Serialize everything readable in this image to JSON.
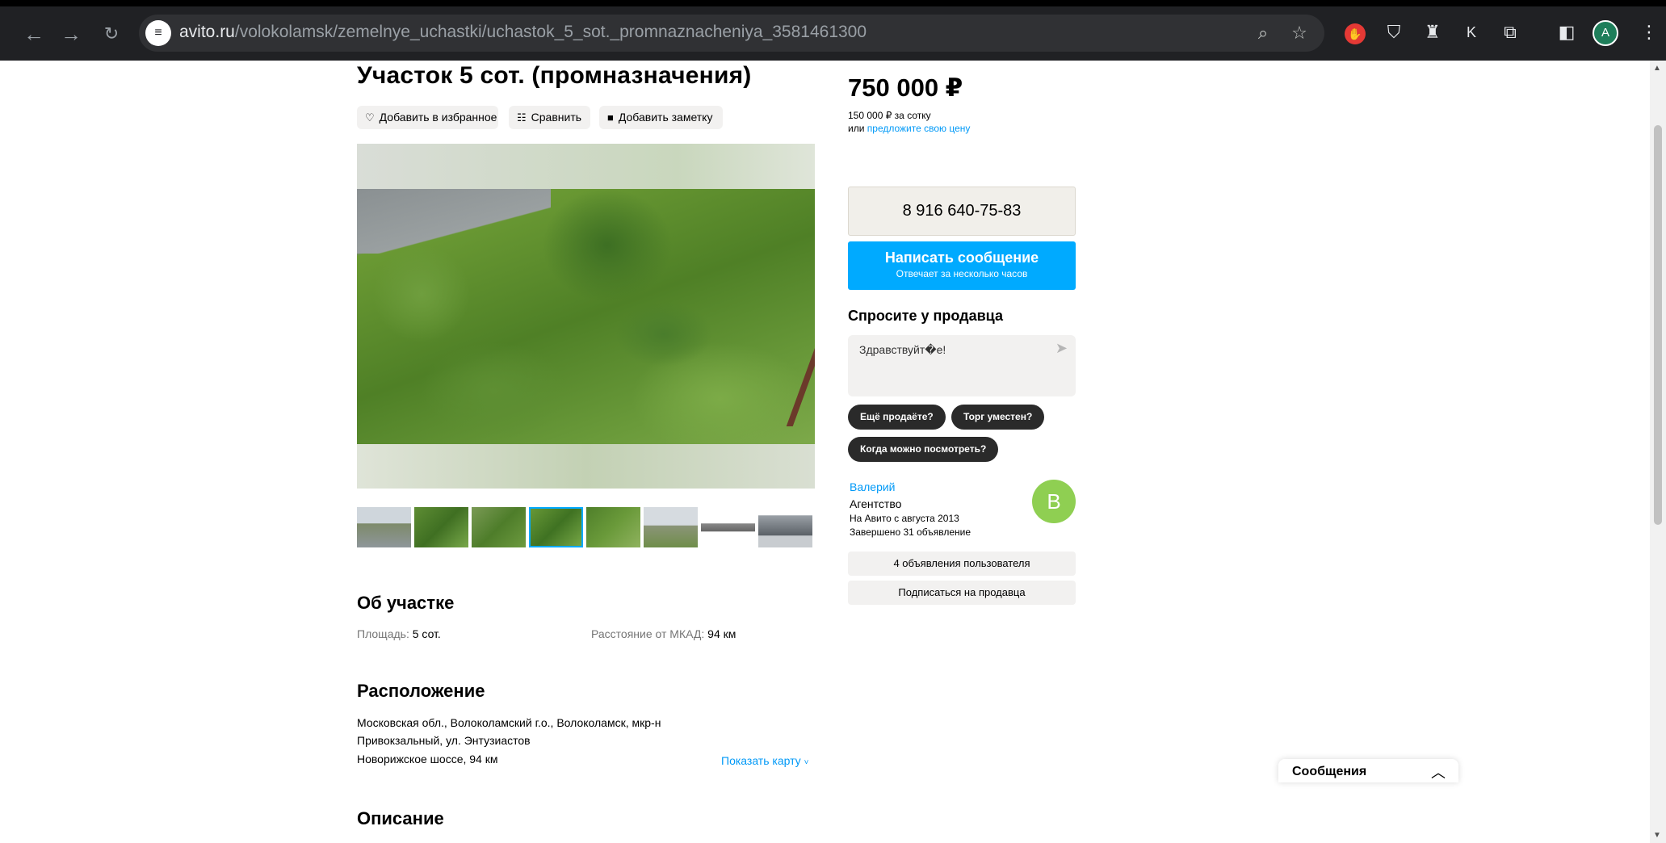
{
  "browser": {
    "url_host": "avito.ru",
    "url_path": "/volokolamsk/zemelnye_uchastki/uchastok_5_sot._promnaznacheniya_3581461300",
    "profile_initial": "A",
    "ext_k_label": "K"
  },
  "listing": {
    "title": "Участок 5 сот. (промназначения)",
    "actions": {
      "favorite": "Добавить в избранное",
      "compare": "Сравнить",
      "note": "Добавить заметку"
    },
    "thumbnails_count": 8,
    "active_thumbnail": 4
  },
  "about": {
    "heading": "Об участке",
    "area_label": "Площадь:",
    "area_value": "5 сот.",
    "distance_label": "Расстояние от МКАД:",
    "distance_value": "94 км"
  },
  "location": {
    "heading": "Расположение",
    "address_line1": "Московская обл., Волоколамский г.о., Волоколамск, мкр-н",
    "address_line2": "Привокзальный, ул. Энтузиастов",
    "highway": " Новорижское шоссе, 94 км",
    "show_map": "Показать карту"
  },
  "description": {
    "heading": "Описание"
  },
  "price": {
    "value": "750 000 ₽",
    "per_unit": "150 000 ₽ за сотку",
    "or": "или",
    "offer_link": "предложите свою цену"
  },
  "contact": {
    "phone": "8 916 640-75-83",
    "message_button": "Написать сообщение",
    "message_sub": "Отвечает за несколько часов",
    "ask_title": "Спросите у продавца",
    "ask_placeholder": "Здравствуйт�е!",
    "quick_questions": [
      "Ещё продаёте?",
      "Торг уместен?",
      "Когда можно посмотреть?"
    ]
  },
  "seller": {
    "name": "Валерий",
    "type": "Агентство",
    "since": "На Авито с августа 2013",
    "completed": "Завершено 31 объявление",
    "avatar_initial": "В",
    "listings_button": "4 объявления пользователя",
    "subscribe_button": "Подписаться на продавца"
  },
  "messages_widget": {
    "label": "Сообщения"
  },
  "colors": {
    "accent": "#00aaff",
    "avatar": "#8fcf52"
  }
}
